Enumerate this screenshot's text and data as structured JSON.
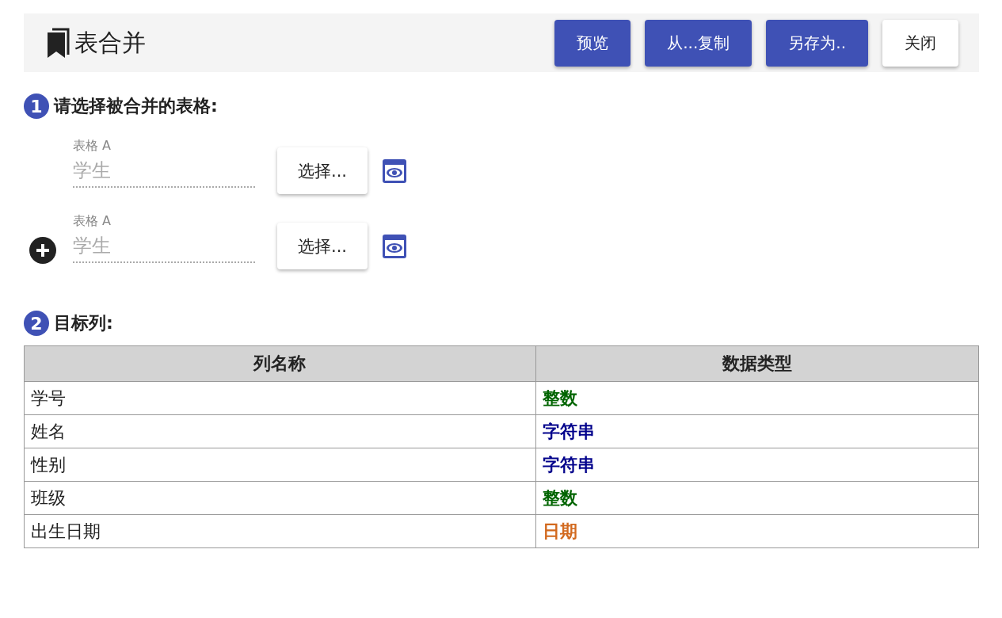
{
  "header": {
    "title": "表合并",
    "buttons": [
      {
        "label": "预览",
        "kind": "primary"
      },
      {
        "label": "从...复制",
        "kind": "primary"
      },
      {
        "label": "另存为..",
        "kind": "primary"
      },
      {
        "label": "关闭",
        "kind": "plain"
      }
    ]
  },
  "step1": {
    "number": "1",
    "title": "请选择被合并的表格:",
    "tables": [
      {
        "label": "表格 A",
        "value": "学生",
        "disabled": true,
        "add_icon": false,
        "button": "选择..."
      },
      {
        "label": "表格 A",
        "value": "学生",
        "disabled": true,
        "add_icon": true,
        "button": "选择..."
      }
    ]
  },
  "step2": {
    "number": "2",
    "title": "目标列:",
    "table": {
      "columns": [
        "列名称",
        "数据类型"
      ],
      "rows": [
        {
          "name": "学号",
          "type": "整数",
          "color": "#006400"
        },
        {
          "name": "姓名",
          "type": "字符串",
          "color": "#00008b"
        },
        {
          "name": "性别",
          "type": "字符串",
          "color": "#00008b"
        },
        {
          "name": "班级",
          "type": "整数",
          "color": "#006400"
        },
        {
          "name": "出生日期",
          "type": "日期",
          "color": "#d2691e"
        }
      ]
    }
  }
}
